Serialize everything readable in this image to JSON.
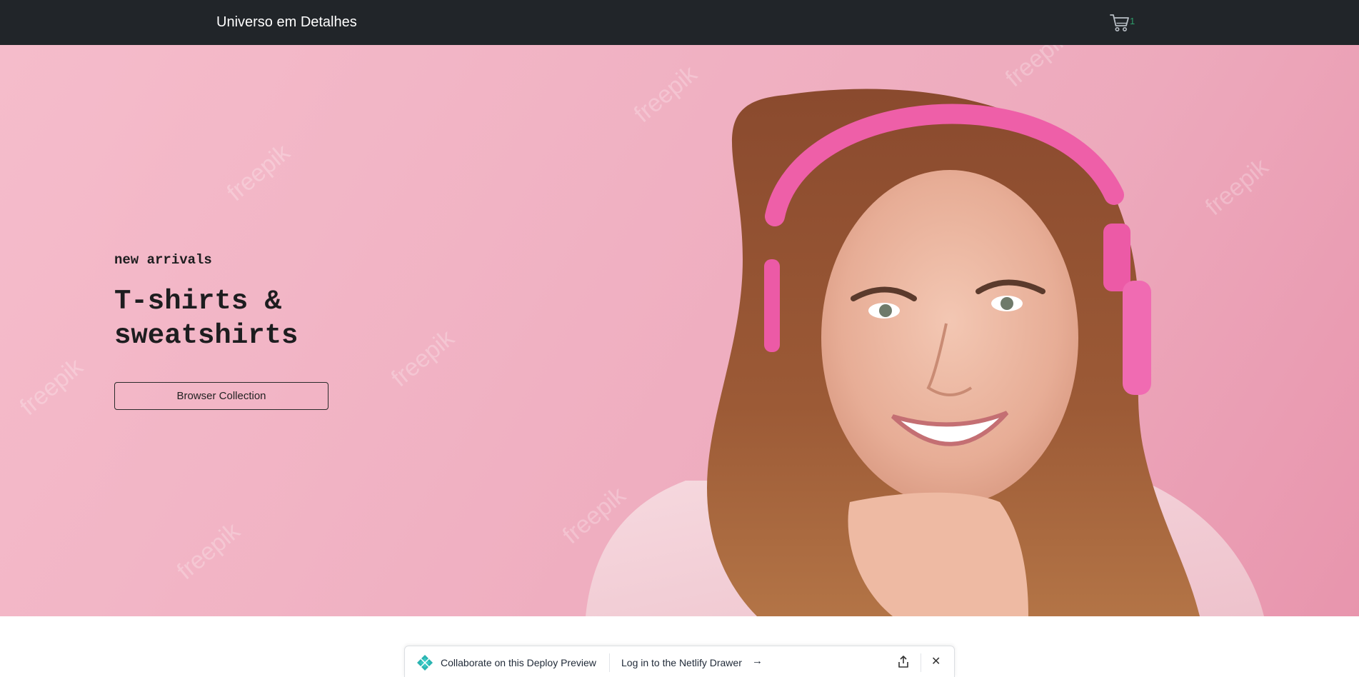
{
  "navbar": {
    "brand": "Universo em Detalhes",
    "cart_icon": "cart-icon",
    "cart_count": "1"
  },
  "hero": {
    "kicker": "new arrivals",
    "title": "T-shirts & sweatshirts",
    "button_label": "Browser Collection",
    "photo_watermark": "freepik"
  },
  "drawer": {
    "logo_icon": "netlify-logo-icon",
    "collab_text": "Collaborate on this Deploy Preview",
    "login_text": "Log in to the Netlify Drawer",
    "arrow": "→",
    "share_icon": "share-icon",
    "close_icon": "close-icon",
    "close_glyph": "✕"
  },
  "colors": {
    "navbar_bg": "#212529",
    "hero_bg": "#f1b3c4",
    "cart_count": "#2e9d6a"
  }
}
